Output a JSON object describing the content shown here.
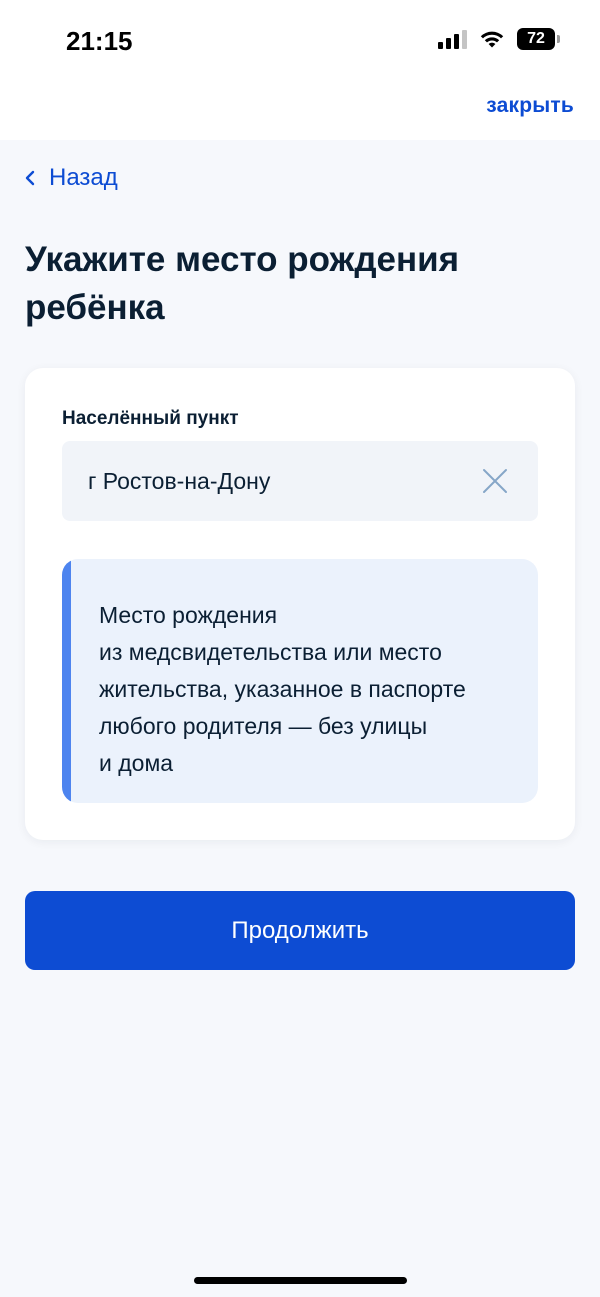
{
  "status_bar": {
    "time": "21:15",
    "battery": "72"
  },
  "header": {
    "close_label": "закрыть"
  },
  "nav": {
    "back_label": "Назад"
  },
  "page": {
    "title": "Укажите место рождения ребёнка"
  },
  "form": {
    "locality_label": "Населённый пункт",
    "locality_value": "г Ростов-на-Дону"
  },
  "info_box": {
    "lines": [
      "Место рождения",
      "из медсвидетельства или место",
      "жительства, указанное в паспорте",
      "любого родителя — без улицы",
      "и дома"
    ],
    "accent_color": "#4d84ef"
  },
  "actions": {
    "continue_label": "Продолжить"
  },
  "colors": {
    "primary": "#0d4cd3",
    "background": "#f6f8fc",
    "text": "#0b1f33"
  },
  "icons": {
    "back": "chevron-left-icon",
    "clear": "close-icon",
    "signal": "cellular-signal-icon",
    "wifi": "wifi-icon",
    "battery": "battery-icon"
  }
}
